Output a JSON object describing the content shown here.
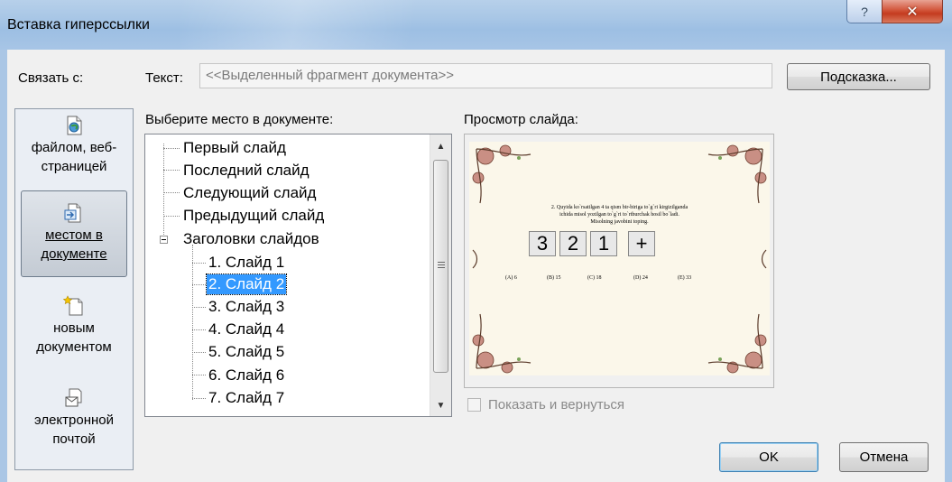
{
  "window": {
    "title": "Вставка гиперссылки",
    "help_glyph": "?",
    "close_glyph": "✕"
  },
  "link_to": {
    "label": "Связать с:",
    "items": [
      {
        "label": "файлом, веб-страницей",
        "icon": "web-page-icon"
      },
      {
        "label": "местом в документе",
        "icon": "place-in-document-icon",
        "active": true
      },
      {
        "label": "новым документом",
        "icon": "new-document-icon"
      },
      {
        "label": "электронной почтой",
        "icon": "email-icon"
      }
    ]
  },
  "text_field": {
    "label": "Текст:",
    "value": "<<Выделенный фрагмент документа>>"
  },
  "hint_button": "Подсказка...",
  "place": {
    "label": "Выберите место в документе:",
    "items": [
      "Первый слайд",
      "Последний слайд",
      "Следующий слайд",
      "Предыдущий слайд",
      "Заголовки слайдов",
      "1. Слайд 1",
      "2. Слайд 2",
      "3. Слайд 3",
      "4. Слайд 4",
      "5. Слайд 5",
      "6. Слайд 6",
      "7. Слайд 7"
    ],
    "selected": "2. Слайд 2"
  },
  "preview": {
    "label": "Просмотр слайда:",
    "slide": {
      "question_line1": "2. Quyida ko`rsatilgan 4 ta qism bir-biriga to`g`ri kirgizilganda",
      "question_line2": "ichida misol yozilgan to`g`ri to`rtburchak hosil bo`ladi.",
      "question_line3": "Misolning javobini toping.",
      "pieces": [
        "3",
        "2",
        "1",
        "+"
      ],
      "answers": [
        "(A) 6",
        "(B) 15",
        "(C) 18",
        "(D) 24",
        "(E) 33"
      ]
    }
  },
  "show_and_return": {
    "label": "Показать и вернуться",
    "checked": false
  },
  "ok_button": "OK",
  "cancel_button": "Отмена",
  "colors": {
    "selection": "#3399ff",
    "titlebar": "#a9c7e6",
    "close": "#c43b1f"
  }
}
